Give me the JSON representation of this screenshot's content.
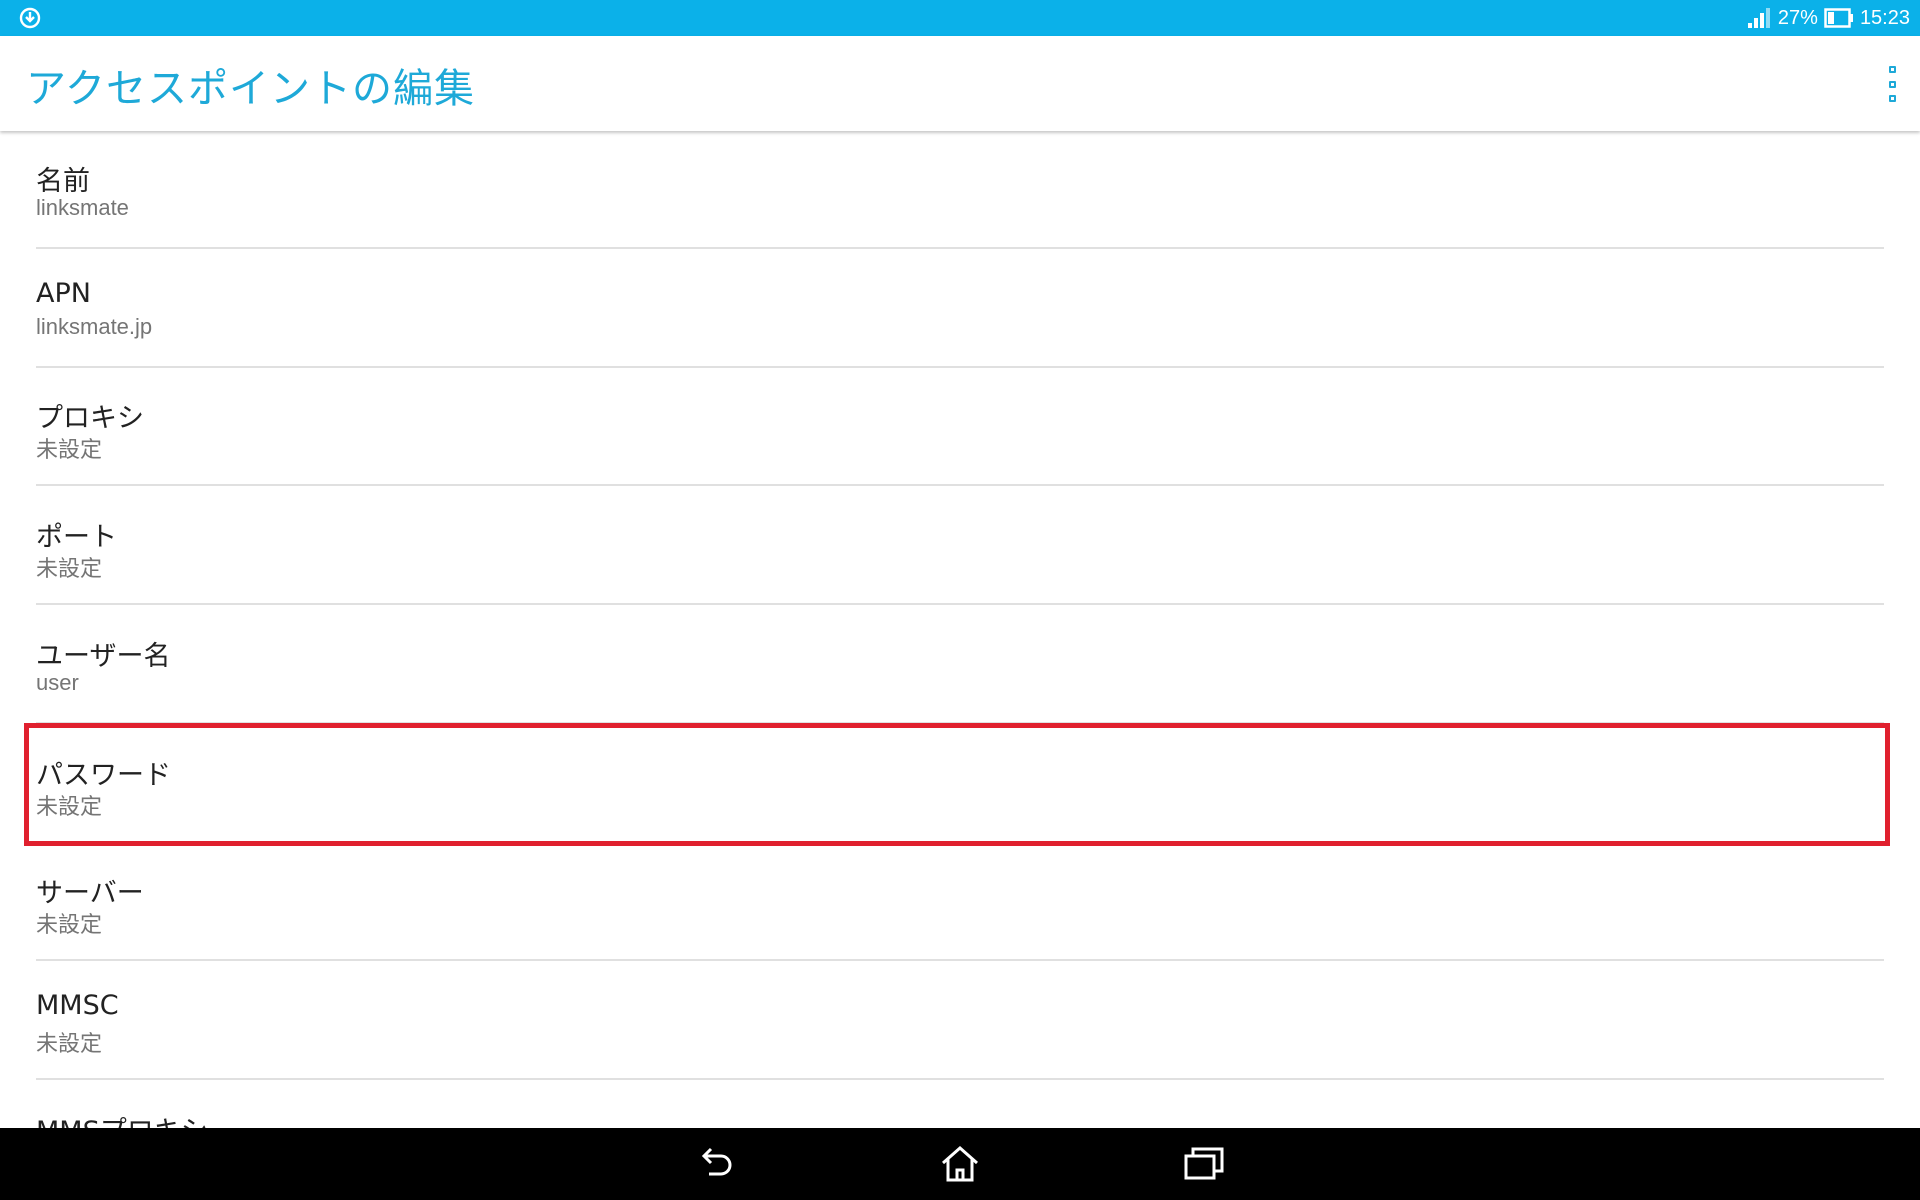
{
  "status_bar": {
    "left_icon": "sync-notification-icon",
    "signal_icon": "cell-signal-icon",
    "battery_percent": "27%",
    "battery_icon": "battery-icon",
    "time": "15:23",
    "background_color": "#0bb1e9"
  },
  "action_bar": {
    "title": "アクセスポイントの編集",
    "overflow_icon": "overflow-menu-icon",
    "accent_color": "#1ea9d8"
  },
  "list": {
    "items": [
      {
        "title": "名前",
        "value": "linksmate"
      },
      {
        "title": "APN",
        "value": "linksmate.jp"
      },
      {
        "title": "プロキシ",
        "value": "未設定"
      },
      {
        "title": "ポート",
        "value": "未設定"
      },
      {
        "title": "ユーザー名",
        "value": "user"
      },
      {
        "title": "パスワード",
        "value": "未設定"
      },
      {
        "title": "サーバー",
        "value": "未設定"
      },
      {
        "title": "MMSC",
        "value": "未設定"
      },
      {
        "title": "MMSプロキシ",
        "value": ""
      }
    ]
  },
  "highlight": {
    "target": "パスワード",
    "color": "#e0202e"
  },
  "nav_bar": {
    "back_icon": "back-icon",
    "home_icon": "home-icon",
    "recents_icon": "recent-apps-icon"
  }
}
